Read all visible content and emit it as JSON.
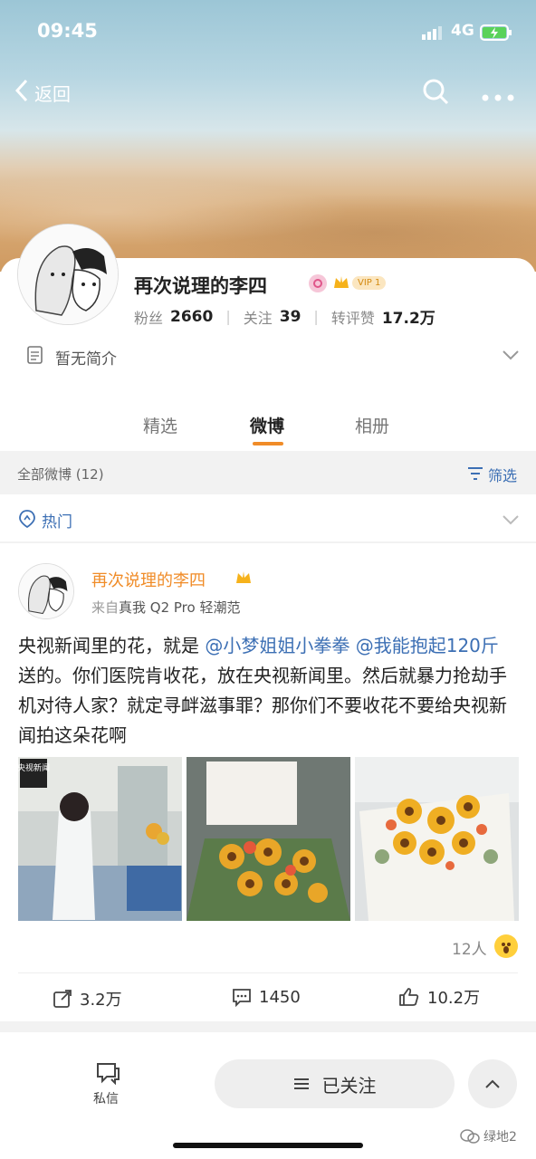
{
  "status_bar": {
    "time": "09:45",
    "network": "4G"
  },
  "nav": {
    "back_label": "返回"
  },
  "profile": {
    "name": "再次说理的李四",
    "vip_badge": "VIP 1",
    "stats": [
      {
        "label": "粉丝",
        "value": "2660"
      },
      {
        "label": "关注",
        "value": "39"
      },
      {
        "label": "转评赞",
        "value": "17.2万"
      }
    ],
    "bio": "暂无简介"
  },
  "tabs": [
    {
      "label": "精选"
    },
    {
      "label": "微博"
    },
    {
      "label": "相册"
    }
  ],
  "filter": {
    "all_label": "全部微博 (12)",
    "filter_label": "筛选"
  },
  "hot": {
    "label": "热门"
  },
  "post": {
    "author": "再次说理的李四",
    "source_prefix": "来自",
    "source": "真我 Q2 Pro 轻潮范",
    "text_1": "央视新闻里的花，就是",
    "mention_1": "@小梦姐姐小拳拳",
    "mention_2": "@我能抱起120斤",
    "text_2": "送的。你们医院肯收花，放在央视新闻里。然后就暴力抢劫手机对待人家？就定寻衅滋事罪？那你们不要收花不要给央视新闻拍这朵花啊",
    "image_1_tag": "央视新闻",
    "reactions": "12人",
    "repost": "3.2万",
    "comment": "1450",
    "like": "10.2万"
  },
  "bottom": {
    "message_label": "私信",
    "follow_label": "已关注"
  },
  "watermark": "绿地2",
  "colors": {
    "accent": "#f08c28",
    "link": "#3c6fb4"
  }
}
